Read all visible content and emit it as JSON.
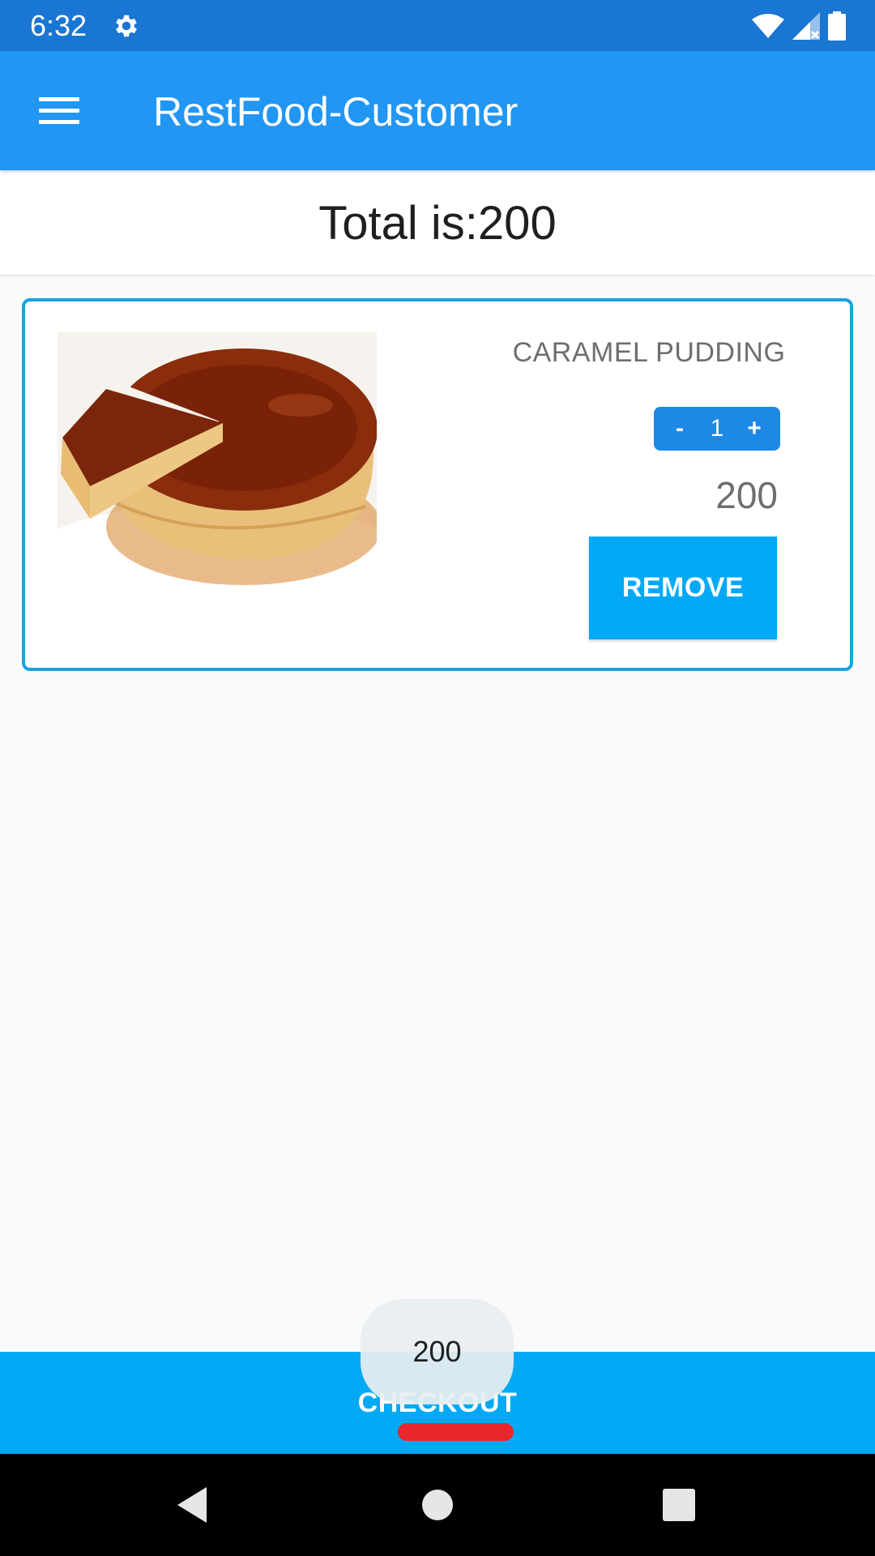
{
  "status_bar": {
    "time": "6:32",
    "icons": [
      "gear-icon",
      "wifi-icon",
      "signal-icon",
      "battery-icon"
    ]
  },
  "app_bar": {
    "menu_icon": "hamburger-menu-icon",
    "title": "RestFood-Customer"
  },
  "summary": {
    "total_text": "Total is:200"
  },
  "cart": {
    "items": [
      {
        "name": "CARAMEL PUDDING",
        "quantity": "1",
        "decrement_label": "-",
        "increment_label": "+",
        "price": "200",
        "remove_label": "REMOVE"
      }
    ]
  },
  "checkout": {
    "label": "CHECKOUT",
    "bubble_value": "200"
  },
  "colors": {
    "status_bar": "#1976d2",
    "app_bar": "#2196f3",
    "accent": "#03a9f4",
    "card_border": "#1ba1e2",
    "underline_mark": "#e8262b"
  },
  "nav_bar": {
    "icons": [
      "back-icon",
      "home-icon",
      "recents-icon"
    ]
  }
}
